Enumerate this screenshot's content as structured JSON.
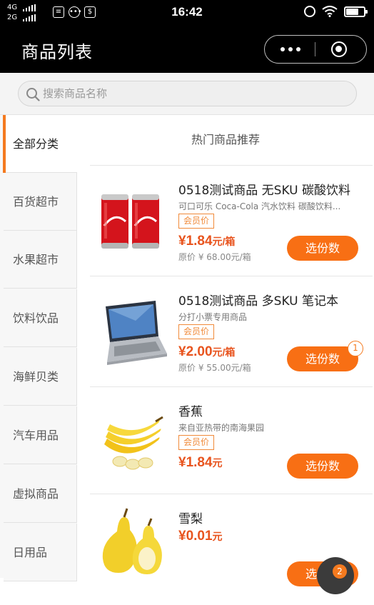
{
  "status_bar": {
    "network_top": "4G",
    "network_bottom": "2G",
    "time": "16:42"
  },
  "nav": {
    "title": "商品列表"
  },
  "search": {
    "placeholder": "搜索商品名称"
  },
  "categories": [
    {
      "label": "全部分类",
      "active": true
    },
    {
      "label": "百货超市",
      "active": false
    },
    {
      "label": "水果超市",
      "active": false
    },
    {
      "label": "饮料饮品",
      "active": false
    },
    {
      "label": "海鲜贝类",
      "active": false
    },
    {
      "label": "汽车用品",
      "active": false
    },
    {
      "label": "虚拟商品",
      "active": false
    },
    {
      "label": "日用品",
      "active": false
    }
  ],
  "section_title": "热门商品推荐",
  "products": [
    {
      "name": "0518测试商品 无SKU 碳酸饮料",
      "desc": "可口可乐 Coca-Cola 汽水饮料 碳酸饮料...",
      "tag": "会员价",
      "price": "¥1.84",
      "unit": "元/箱",
      "original": "原价 ¥ 68.00元/箱",
      "button": "选份数",
      "image_icon": "cola-cans-icon"
    },
    {
      "name": "0518测试商品 多SKU 笔记本",
      "desc": "分打小票专用商品",
      "tag": "会员价",
      "price": "¥2.00",
      "unit": "元/箱",
      "original": "原价 ¥ 55.00元/箱",
      "button": "选份数",
      "badge": "1",
      "image_icon": "laptop-icon"
    },
    {
      "name": "香蕉",
      "desc": "来自亚热带的南海果园",
      "tag": "会员价",
      "price": "¥1.84",
      "unit": "元",
      "button": "选份数",
      "image_icon": "banana-icon"
    },
    {
      "name": "雪梨",
      "price": "¥0.01",
      "unit": "元",
      "button": "选份数",
      "image_icon": "pear-icon"
    }
  ],
  "cart": {
    "count": "2"
  },
  "colors": {
    "accent": "#f86f14",
    "price": "#e8541e",
    "nav_bg": "#000000"
  }
}
